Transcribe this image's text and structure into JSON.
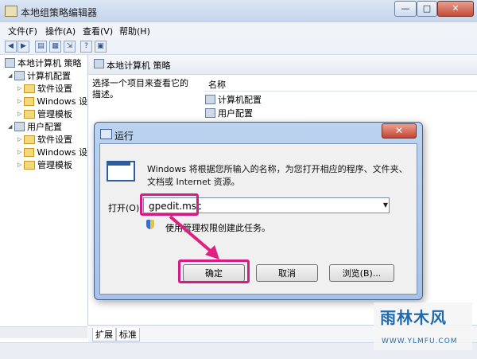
{
  "window": {
    "title": "本地组策略编辑器",
    "controls": {
      "minimize": "—",
      "maximize": "□",
      "close": "✕"
    }
  },
  "menu": [
    "文件(F)",
    "操作(A)",
    "查看(V)",
    "帮助(H)"
  ],
  "toolbar_icons": [
    "back-icon",
    "forward-icon",
    "show-tree-icon",
    "properties-icon",
    "export-icon",
    "help-icon",
    "filter-icon"
  ],
  "tree": {
    "root": "本地计算机 策略",
    "computer": "计算机配置",
    "computer_children": [
      "软件设置",
      "Windows 设",
      "管理模板"
    ],
    "user": "用户配置",
    "user_children": [
      "软件设置",
      "Windows 设",
      "管理模板"
    ]
  },
  "right": {
    "header": "本地计算机 策略",
    "description": "选择一个项目来查看它的描述。",
    "column_name": "名称",
    "items": [
      "计算机配置",
      "用户配置"
    ]
  },
  "tabs": [
    "扩展",
    "标准"
  ],
  "dialog": {
    "title": "运行",
    "close": "✕",
    "description": "Windows 将根据您所输入的名称，为您打开相应的程序、文件夹、文档或 Internet 资源。",
    "open_label": "打开(O):",
    "open_value": "gpedit.msc",
    "admin_note": "使用管理权限创建此任务。",
    "buttons": {
      "ok": "确定",
      "cancel": "取消",
      "browse": "浏览(B)..."
    }
  },
  "watermark": {
    "main": "雨林木风",
    "url": "WWW.YLMFU.COM"
  },
  "colors": {
    "highlight": "#d61b84",
    "arrow": "#e0207f"
  }
}
